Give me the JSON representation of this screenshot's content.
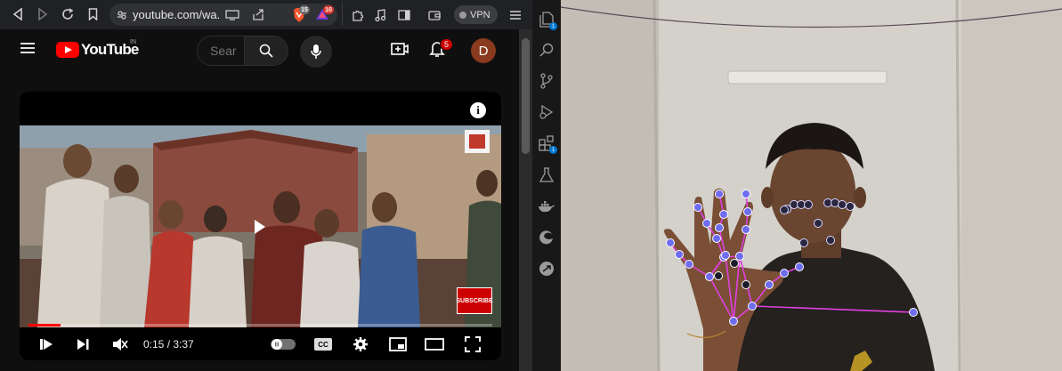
{
  "browser": {
    "url": "youtube.com/wa...",
    "brave_shield_count": "15",
    "rewards_count": "10",
    "vpn_label": "VPN"
  },
  "youtube": {
    "logo_text": "YouTube",
    "region": "IN",
    "search_placeholder": "Sear",
    "notification_count": "5",
    "avatar_letter": "D",
    "player": {
      "current_time": "0:15",
      "duration": "3:37",
      "time_display": "0:15 / 3:37",
      "progress_fraction": 0.069,
      "cc_label": "CC",
      "overlay_badge": "SUBSCRIBE",
      "info_icon": "i"
    }
  },
  "vscode": {
    "explorer_badge": "1",
    "extensions_badge": "1"
  },
  "camera": {
    "hand_landmarks": "21",
    "face_landmarks": "12"
  },
  "colors": {
    "yt_red": "#ff0000",
    "landmark_fill": "#6e6cf0",
    "connection": "#e040e0",
    "vscode_bg": "#181818"
  }
}
